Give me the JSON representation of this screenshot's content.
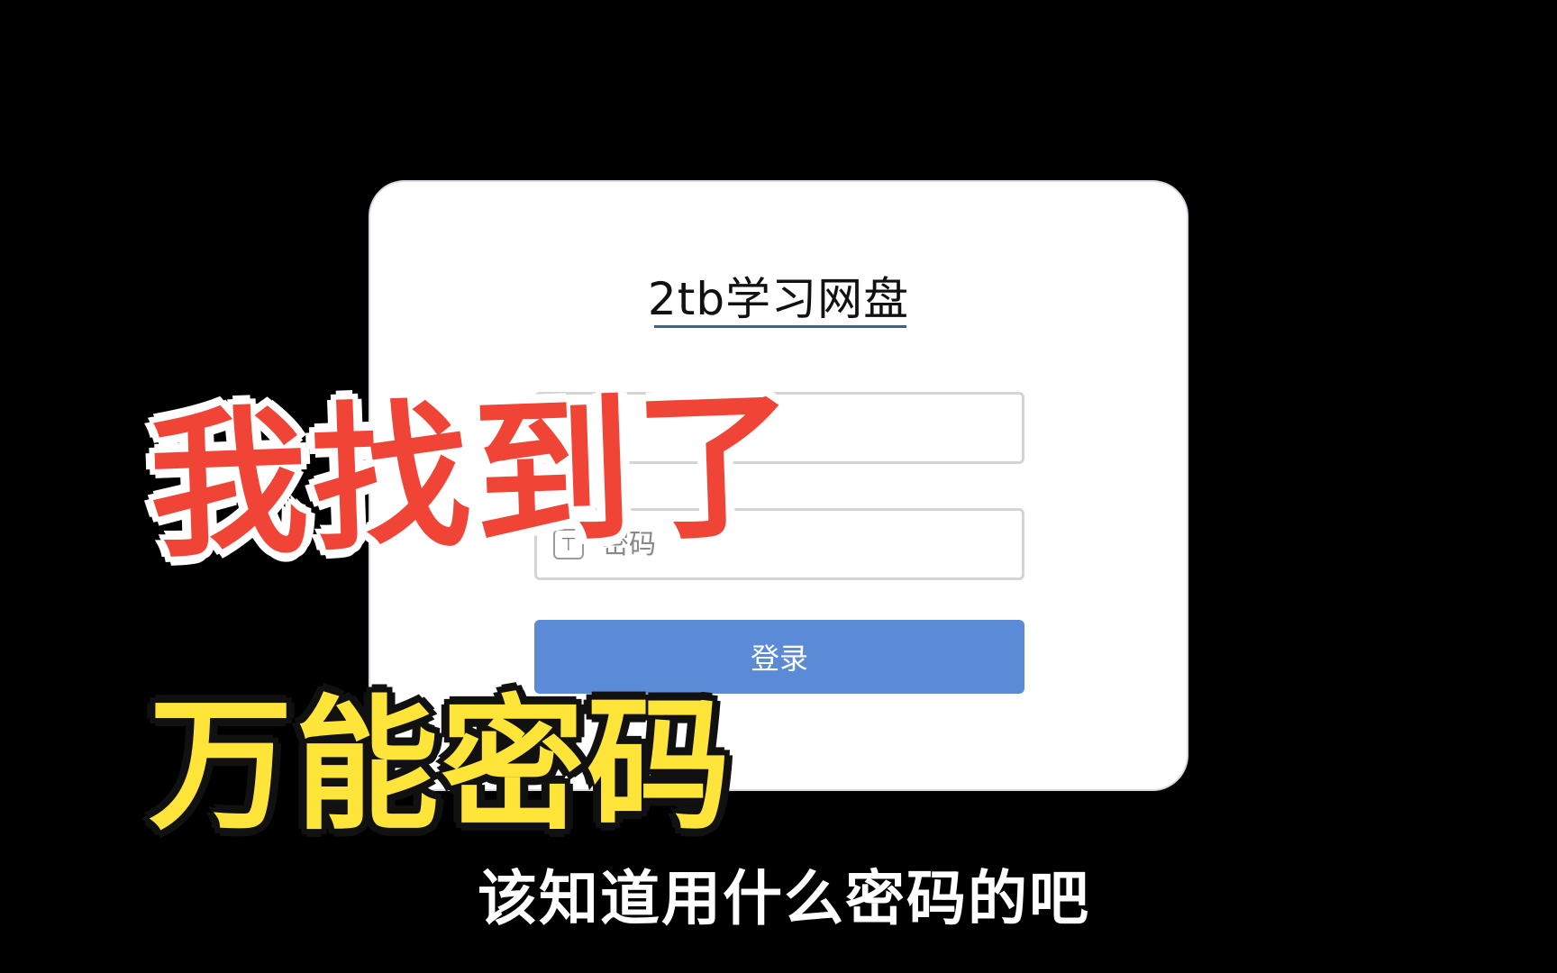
{
  "login": {
    "title": "2tb学习网盘",
    "username_placeholder": "",
    "password_placeholder": "密码",
    "submit_label": "登录"
  },
  "overlay": {
    "headline": "我找到了",
    "subheadline": "万能密码",
    "caption": "该知道用什么密码的吧"
  },
  "colors": {
    "background": "#000000",
    "button": "#5b8ad6",
    "headline": "#f04536",
    "subheadline": "#ffe43a"
  },
  "icons": {
    "password": "lock-icon"
  }
}
